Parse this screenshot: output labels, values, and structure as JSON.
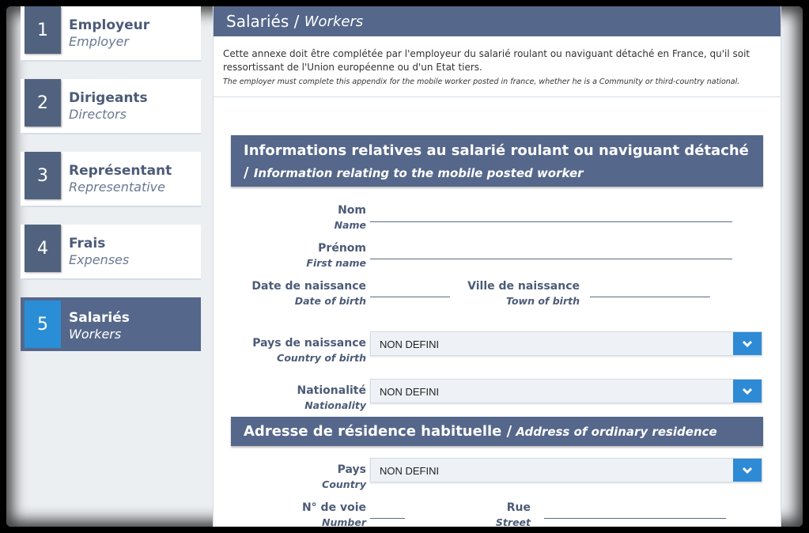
{
  "sidebar": {
    "steps": [
      {
        "num": "1",
        "fr": "Employeur",
        "en": "Employer"
      },
      {
        "num": "2",
        "fr": "Dirigeants",
        "en": "Directors"
      },
      {
        "num": "3",
        "fr": "Représentant",
        "en": "Representative"
      },
      {
        "num": "4",
        "fr": "Frais",
        "en": "Expenses"
      },
      {
        "num": "5",
        "fr": "Salariés",
        "en": "Workers"
      }
    ],
    "active_step": "5"
  },
  "header": {
    "title_fr": "Salariés / ",
    "title_en": "Workers"
  },
  "intro": {
    "fr": "Cette annexe doit être complétée par l'employeur du salarié roulant ou naviguant détaché en France, qu'il soit ressortissant de l'Union européenne ou d'un Etat tiers.",
    "en": "The employer must complete this appendix for the mobile worker posted in france, whether he is a Community or third-country national."
  },
  "section1": {
    "fr": "Informations relatives au salarié roulant ou naviguant détaché / ",
    "en": "Information relating to the mobile posted worker"
  },
  "fields": {
    "nom": {
      "fr": "Nom",
      "en": "Name",
      "value": ""
    },
    "prenom": {
      "fr": "Prénom",
      "en": "First name",
      "value": ""
    },
    "dob": {
      "fr": "Date de naissance",
      "en": "Date of birth",
      "value": ""
    },
    "town": {
      "fr": "Ville de naissance",
      "en": "Town of birth",
      "value": ""
    },
    "country_birth": {
      "fr": "Pays de naissance",
      "en": "Country of birth",
      "value": "NON DEFINI"
    },
    "nationality": {
      "fr": "Nationalité",
      "en": "Nationality",
      "value": "NON DEFINI"
    }
  },
  "section2": {
    "fr": "Adresse de résidence habituelle / ",
    "en": "Address of ordinary residence"
  },
  "address": {
    "pays": {
      "fr": "Pays",
      "en": "Country",
      "value": "NON DEFINI"
    },
    "voie": {
      "fr": "N° de voie",
      "en": "Number",
      "value": ""
    },
    "rue": {
      "fr": "Rue",
      "en": "Street",
      "value": ""
    }
  },
  "colors": {
    "accent": "#55678a",
    "active": "#2a8ed6",
    "button": "#2f8ad6"
  },
  "icons": {
    "dropdown": "chevron-down-icon"
  }
}
